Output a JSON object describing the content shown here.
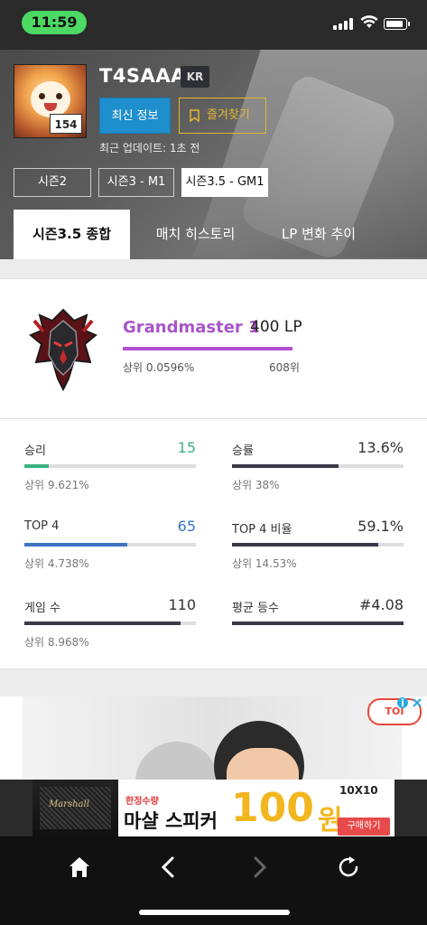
{
  "status_bar": {
    "time": "11:59"
  },
  "profile": {
    "summoner_name": "T4SAAA",
    "region": "KR",
    "level": "154",
    "refresh_label": "최신 정보",
    "favorite_label": "즐겨찾기",
    "updated_text": "최근 업데이트: 1초 전"
  },
  "seasons": [
    {
      "label": "시즌2",
      "active": false
    },
    {
      "label": "시즌3 - M1",
      "active": false
    },
    {
      "label": "시즌3.5 - GM1",
      "active": true
    }
  ],
  "tabs": [
    {
      "label": "시즌3.5 종합",
      "active": true
    },
    {
      "label": "매치 히스토리",
      "active": false
    },
    {
      "label": "LP 변화 추이",
      "active": false
    }
  ],
  "rank": {
    "tier": "Grandmaster 1",
    "lp": "400 LP",
    "top_percent": "상위 0.0596%",
    "rank_position": "608위",
    "tier_color": "#a855c8"
  },
  "stats": [
    {
      "label": "승리",
      "value": "15",
      "sub": "상위 9.621%",
      "fill": 0.14,
      "color": "#3bb27e",
      "value_color": "#3bb27e"
    },
    {
      "label": "승률",
      "value": "13.6%",
      "sub": "상위 38%",
      "fill": 0.62,
      "color": "#3a3a4a",
      "value_color": "#333333"
    },
    {
      "label": "TOP 4",
      "value": "65",
      "sub": "상위 4.738%",
      "fill": 0.6,
      "color": "#3d74c4",
      "value_color": "#3d74c4"
    },
    {
      "label": "TOP 4 비율",
      "value": "59.1%",
      "sub": "상위 14.53%",
      "fill": 0.85,
      "color": "#3a3a4a",
      "value_color": "#333333"
    },
    {
      "label": "게임 수",
      "value": "110",
      "sub": "상위 8.968%",
      "fill": 0.91,
      "color": "#3a3a4a",
      "value_color": "#333333"
    },
    {
      "label": "평균 등수",
      "value": "#4.08",
      "sub": "",
      "fill": 1.0,
      "color": "#3a3a4a",
      "value_color": "#333333"
    }
  ],
  "ad": {
    "badge": "TOI",
    "banner": {
      "brand_small": "한정수량",
      "product": "마샬 스피커",
      "price": "100",
      "currency": "원",
      "vendor": "10X10",
      "cta": "구매하기"
    }
  },
  "bottom_nav": {
    "home_icon": "home-icon",
    "back_icon": "chevron-left-icon",
    "forward_icon": "chevron-right-icon",
    "reload_icon": "reload-icon"
  }
}
